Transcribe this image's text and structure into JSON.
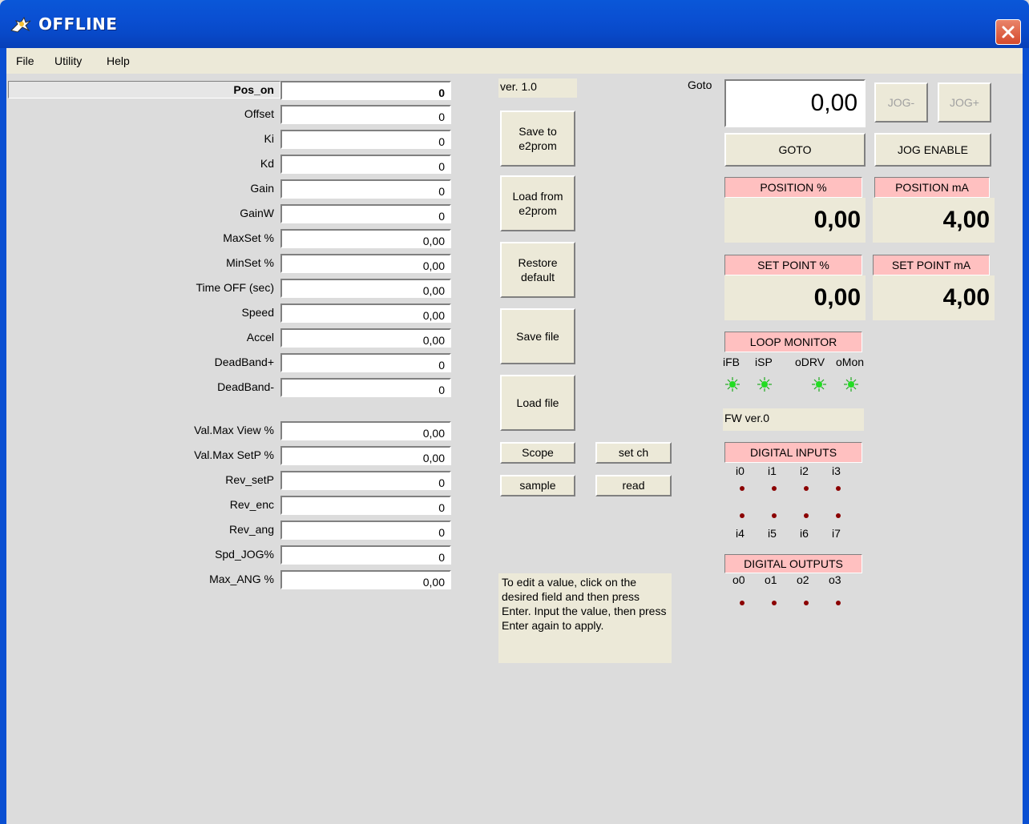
{
  "window": {
    "title": "OFFLINE"
  },
  "menu": {
    "file": "File",
    "utility": "Utility",
    "help": "Help"
  },
  "params": {
    "pos_on": {
      "label": "Pos_on",
      "value": "0"
    },
    "group1": [
      {
        "label": "Offset",
        "value": "0"
      },
      {
        "label": "Ki",
        "value": "0"
      },
      {
        "label": "Kd",
        "value": "0"
      },
      {
        "label": "Gain",
        "value": "0"
      },
      {
        "label": "GainW",
        "value": "0"
      },
      {
        "label": "MaxSet %",
        "value": "0,00"
      },
      {
        "label": "MinSet %",
        "value": "0,00"
      },
      {
        "label": "Time OFF (sec)",
        "value": "0,00"
      },
      {
        "label": "Speed",
        "value": "0,00"
      },
      {
        "label": "Accel",
        "value": "0,00"
      },
      {
        "label": "DeadBand+",
        "value": "0"
      },
      {
        "label": "DeadBand-",
        "value": "0"
      }
    ],
    "group2": [
      {
        "label": "Val.Max View %",
        "value": "0,00"
      },
      {
        "label": "Val.Max SetP %",
        "value": "0,00"
      },
      {
        "label": "Rev_setP",
        "value": "0"
      },
      {
        "label": "Rev_enc",
        "value": "0"
      },
      {
        "label": "Rev_ang",
        "value": "0"
      },
      {
        "label": "Spd_JOG%",
        "value": "0"
      },
      {
        "label": "Max_ANG %",
        "value": "0,00"
      }
    ]
  },
  "middle": {
    "version": "ver. 1.0",
    "save_e2prom": "Save to e2prom",
    "load_e2prom": "Load from e2prom",
    "restore_default": "Restore default",
    "save_file": "Save file",
    "load_file": "Load file",
    "scope": "Scope",
    "set_ch": "set ch",
    "sample": "sample",
    "read": "read",
    "help_text": "To edit a value, click on the desired field and then press Enter. Input the value, then press Enter again to apply."
  },
  "right": {
    "goto_label": "Goto",
    "goto_value": "0,00",
    "jog_minus": "JOG-",
    "jog_plus": "JOG+",
    "goto_button": "GOTO",
    "jog_enable": "JOG ENABLE",
    "position_pct_label": "POSITION %",
    "position_pct_value": "0,00",
    "position_ma_label": "POSITION mA",
    "position_ma_value": "4,00",
    "setpoint_pct_label": "SET POINT %",
    "setpoint_pct_value": "0,00",
    "setpoint_ma_label": "SET POINT mA",
    "setpoint_ma_value": "4,00",
    "loop_monitor": "LOOP MONITOR",
    "loop_signals": [
      "iFB",
      "iSP",
      "oDRV",
      "oMon"
    ],
    "fw_version": "FW ver.0",
    "digital_inputs": "DIGITAL INPUTS",
    "inputs_top": [
      "i0",
      "i1",
      "i2",
      "i3"
    ],
    "inputs_bottom": [
      "i4",
      "i5",
      "i6",
      "i7"
    ],
    "digital_outputs": "DIGITAL OUTPUTS",
    "outputs": [
      "o0",
      "o1",
      "o2",
      "o3"
    ]
  },
  "colors": {
    "led_on": "#22dd22",
    "indicator_off": "#8b0000",
    "label_bg": "#ffc0c0"
  }
}
